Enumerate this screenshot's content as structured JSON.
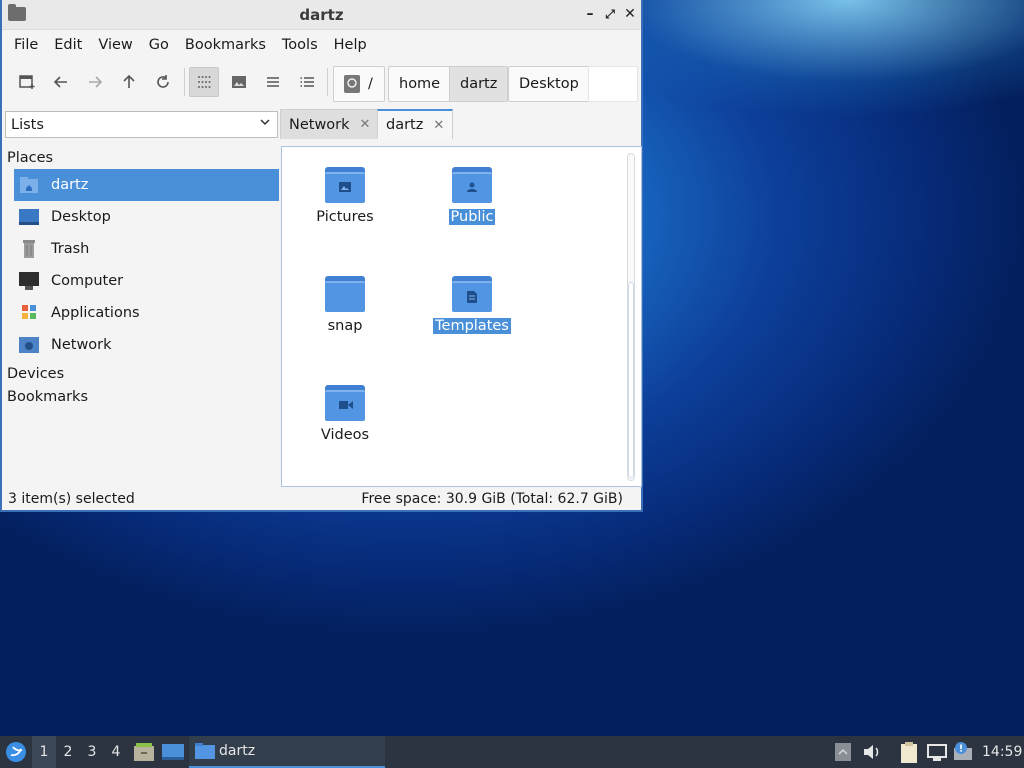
{
  "window": {
    "title": "dartz",
    "controls": {
      "minimize": "–",
      "maximize": "⤢",
      "close": "✕"
    }
  },
  "menubar": [
    "File",
    "Edit",
    "View",
    "Go",
    "Bookmarks",
    "Tools",
    "Help"
  ],
  "toolbar": {
    "breadcrumbs": [
      "/",
      "home",
      "dartz",
      "Desktop"
    ]
  },
  "side_pane_mode": "Lists",
  "tabs": [
    {
      "label": "Network",
      "close": "✕",
      "active": false
    },
    {
      "label": "dartz",
      "close": "✕",
      "active": true
    }
  ],
  "sidebar": {
    "places_header": "Places",
    "items": [
      {
        "label": "dartz",
        "icon": "home-folder-icon",
        "selected": true
      },
      {
        "label": "Desktop",
        "icon": "desktop-icon",
        "selected": false
      },
      {
        "label": "Trash",
        "icon": "trash-icon",
        "selected": false
      },
      {
        "label": "Computer",
        "icon": "computer-icon",
        "selected": false
      },
      {
        "label": "Applications",
        "icon": "applications-icon",
        "selected": false
      },
      {
        "label": "Network",
        "icon": "network-icon",
        "selected": false
      }
    ],
    "devices_header": "Devices",
    "bookmarks_header": "Bookmarks"
  },
  "files": [
    {
      "name": "Pictures",
      "emblem": "image",
      "selected": false
    },
    {
      "name": "Public",
      "emblem": "person",
      "selected": true
    },
    {
      "name": "snap",
      "emblem": "",
      "selected": false
    },
    {
      "name": "Templates",
      "emblem": "document",
      "selected": true
    },
    {
      "name": "Videos",
      "emblem": "video",
      "selected": false
    }
  ],
  "status": {
    "left": "3 item(s) selected",
    "right": "Free space: 30.9 GiB (Total: 62.7 GiB)"
  },
  "taskbar": {
    "desktops": [
      "1",
      "2",
      "3",
      "4"
    ],
    "active_desktop": "1",
    "task_label": "dartz",
    "clock": "14:59"
  },
  "colors": {
    "accent": "#4a90d9",
    "folder": "#5295e3",
    "taskbar": "#2b3440"
  }
}
